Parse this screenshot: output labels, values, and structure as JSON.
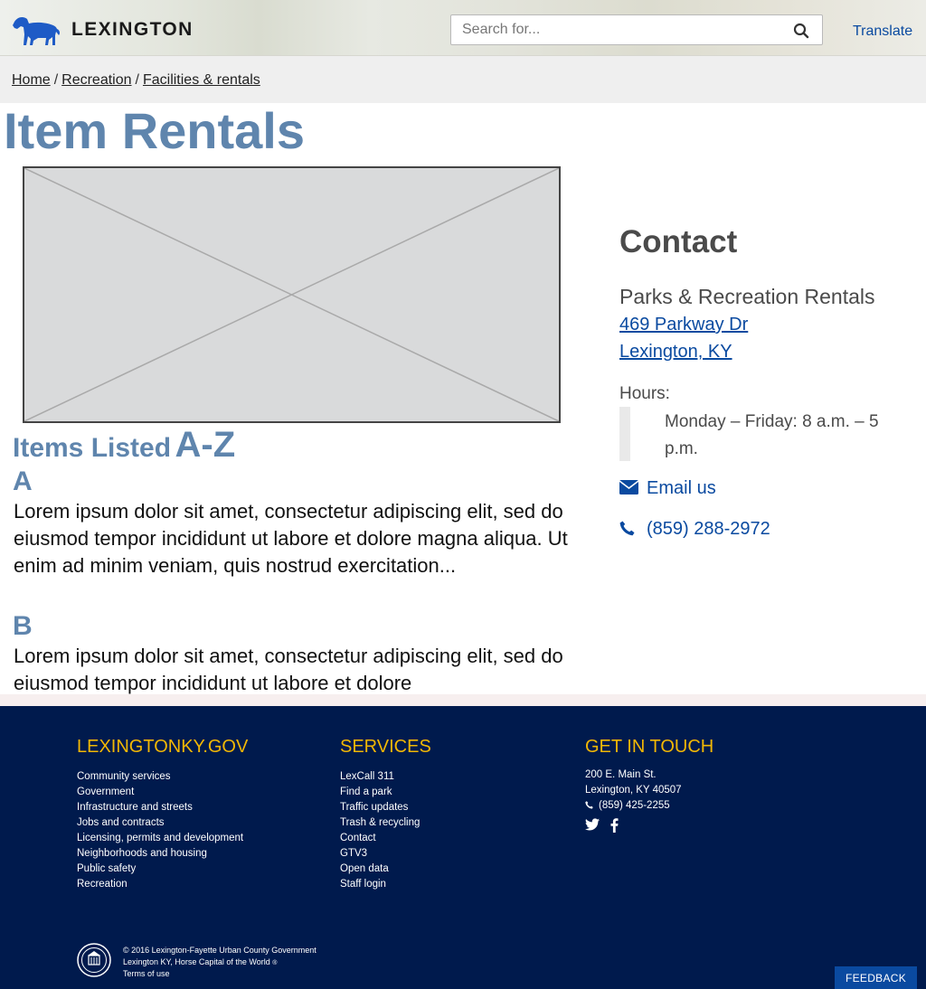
{
  "header": {
    "brand": "LEXINGTON",
    "search_placeholder": "Search for...",
    "translate_label": "Translate"
  },
  "breadcrumb": {
    "items": [
      "Home",
      "Recreation",
      "Facilities & rentals"
    ],
    "separator": "/"
  },
  "main": {
    "title": "Item Rentals",
    "items_heading_small": "Items Listed",
    "items_heading_big": "A-Z",
    "sections": [
      {
        "letter": "A",
        "text": "Lorem ipsum dolor sit amet, consectetur adipiscing elit, sed do eiusmod tempor incididunt ut labore et dolore magna aliqua. Ut enim ad minim veniam, quis nostrud exercitation..."
      },
      {
        "letter": "B",
        "text": "Lorem ipsum dolor sit amet, consectetur adipiscing elit, sed do eiusmod tempor incididunt ut labore et dolore"
      }
    ]
  },
  "contact": {
    "title": "Contact",
    "org": "Parks & Recreation Rentals",
    "address_line1": "469 Parkway Dr",
    "address_line2": "Lexington, KY",
    "hours_label": "Hours:",
    "hours_text": "Monday – Friday: 8 a.m. – 5 p.m.",
    "email_label": "Email us",
    "phone": "(859) 288-2972"
  },
  "footer": {
    "col1_title": "LEXINGTONKY.GOV",
    "col1_links": [
      "Community services",
      "Government",
      "Infrastructure and streets",
      "Jobs and contracts",
      "Licensing, permits and development",
      "Neighborhoods and housing",
      "Public safety",
      "Recreation"
    ],
    "col2_title": "SERVICES",
    "col2_links": [
      "LexCall 311",
      "Find a park",
      "Traffic updates",
      "Trash & recycling",
      "Contact",
      "GTV3",
      "Open data",
      "Staff login"
    ],
    "col3_title": "GET IN TOUCH",
    "address_line1": "200 E. Main St.",
    "address_line2": "Lexington, KY 40507",
    "phone": "(859) 425-2255",
    "copyright": "© 2016 Lexington-Fayette Urban County Government",
    "tagline": "Lexington KY, Horse Capital of the World",
    "terms": "Terms of use",
    "feedback": "FEEDBACK"
  },
  "colors": {
    "heading_blue": "#5f85ad",
    "link_blue": "#0a4aa0",
    "footer_navy": "#001a4d",
    "footer_gold": "#f2b705"
  },
  "icons": [
    "horse-logo-icon",
    "search-icon",
    "envelope-icon",
    "phone-icon",
    "twitter-icon",
    "facebook-icon",
    "city-seal-icon"
  ]
}
